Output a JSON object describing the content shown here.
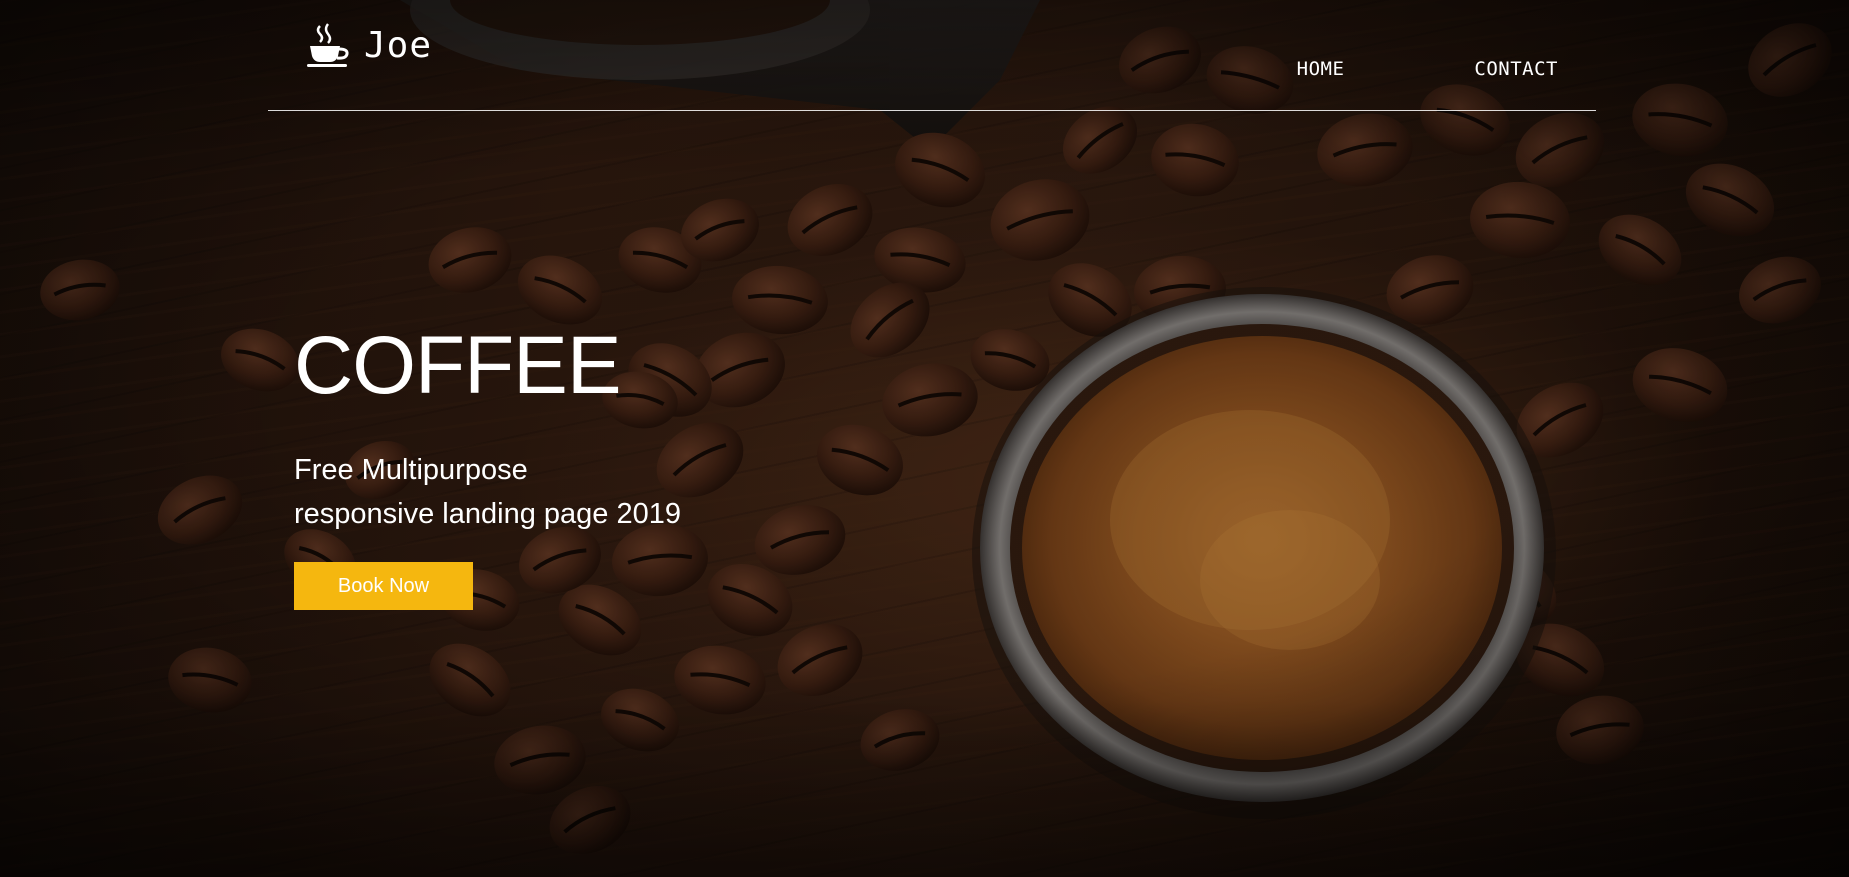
{
  "header": {
    "brand_name": "Joe",
    "brand_icon": "coffee-cup-icon",
    "nav": [
      {
        "label": "HOME"
      },
      {
        "label": "CONTACT"
      }
    ]
  },
  "hero": {
    "title": "COFFEE",
    "subtitle_line1": "Free Multipurpose",
    "subtitle_line2": "responsive landing page 2019",
    "cta_label": "Book Now",
    "background": "coffee-beans-and-espresso-photo"
  },
  "colors": {
    "accent": "#f5b70f",
    "text": "#ffffff",
    "background": "#1f120a"
  }
}
